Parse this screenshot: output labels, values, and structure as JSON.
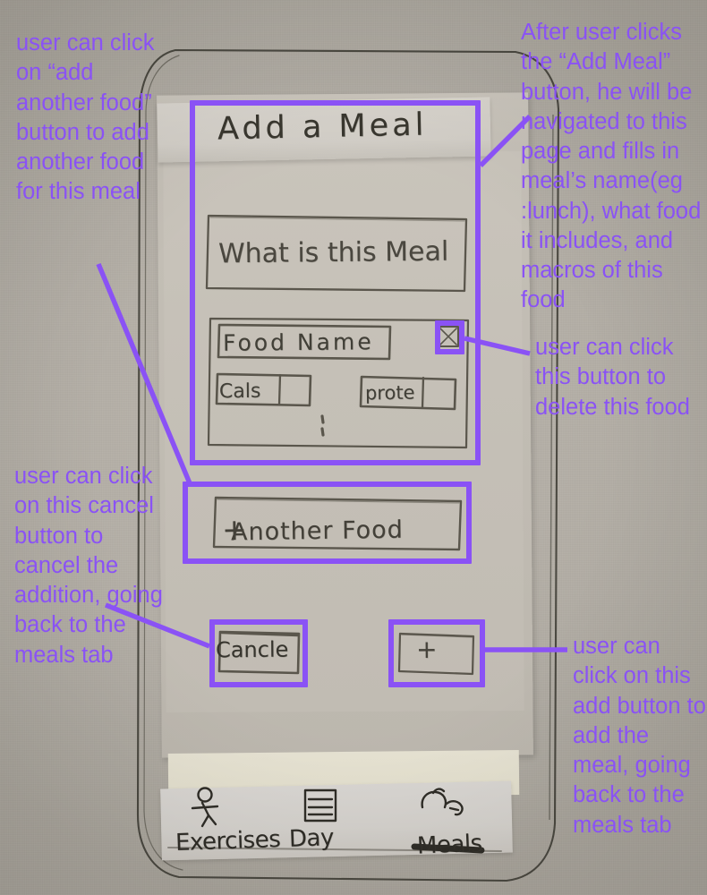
{
  "meta": {
    "kind": "hand-drawn paper wireframe photograph with purple digital annotations",
    "screen_title": "Add a Meal"
  },
  "accent": {
    "annotation_purple": "#8a52f5",
    "pencil_gray": "#3b3933",
    "paper_background": "#b5b0a7",
    "screen_paper": "#c6c1b8"
  },
  "wireframe": {
    "title": "Add a Meal",
    "meal_name_field": {
      "label": "What is this Meal",
      "placeholder": "What is this Meal"
    },
    "food_card": {
      "food_name_field": {
        "label": "Food Name",
        "placeholder": "Food Name"
      },
      "delete_icon": "x-box-icon",
      "macros": [
        {
          "label": "Cals",
          "value": ""
        },
        {
          "label": "prote",
          "value": ""
        }
      ],
      "more_indicator": "vertical-ellipsis"
    },
    "another_food_button": {
      "plus": "+",
      "label": "Another Food",
      "full_label": "+ Another Food"
    },
    "footer_buttons": {
      "cancel_label": "Cancle",
      "add_label": "+"
    },
    "bottom_nav": [
      {
        "id": "exercises",
        "label": "Exercises",
        "icon": "running-person-icon",
        "active": false
      },
      {
        "id": "day",
        "label": "Day",
        "icon": "calendar-list-icon",
        "active": false
      },
      {
        "id": "meals",
        "label": "Meals",
        "icon": "bowl-icon",
        "active": true
      }
    ]
  },
  "annotations": {
    "top_left": "user can click on “add another food” button to add another food for this meal",
    "top_right": "After user clicks the “Add Meal” button, he will be navigated to this page  and fills in meal’s name(eg :lunch), what food it includes, and macros of this food",
    "middle_right": "user can click this button to delete this food",
    "bottom_left": "user can click on this cancel button to cancel the addition, going back to the meals tab",
    "bottom_right": "user can click on this add button to add the meal, going back to the meals tab"
  }
}
